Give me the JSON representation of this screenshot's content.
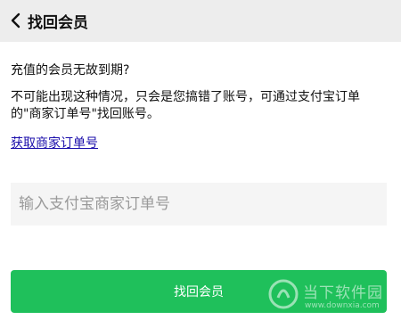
{
  "header": {
    "title": "找回会员",
    "back_icon": "chevron-left-icon"
  },
  "content": {
    "question": "充值的会员无故到期?",
    "answer": "不可能出现这种情况，只会是您搞错了账号，可通过支付宝订单的\"商家订单号\"找回账号。",
    "link_label": "获取商家订单号"
  },
  "form": {
    "order_input_placeholder": "输入支付宝商家订单号",
    "order_input_value": "",
    "submit_label": "找回会员"
  },
  "watermark": {
    "text": "当下软件园",
    "sub": "www.downxia.com"
  },
  "colors": {
    "header_bg": "#ededed",
    "accent_green": "#1fc05b",
    "link_blue": "#1a0dab"
  }
}
